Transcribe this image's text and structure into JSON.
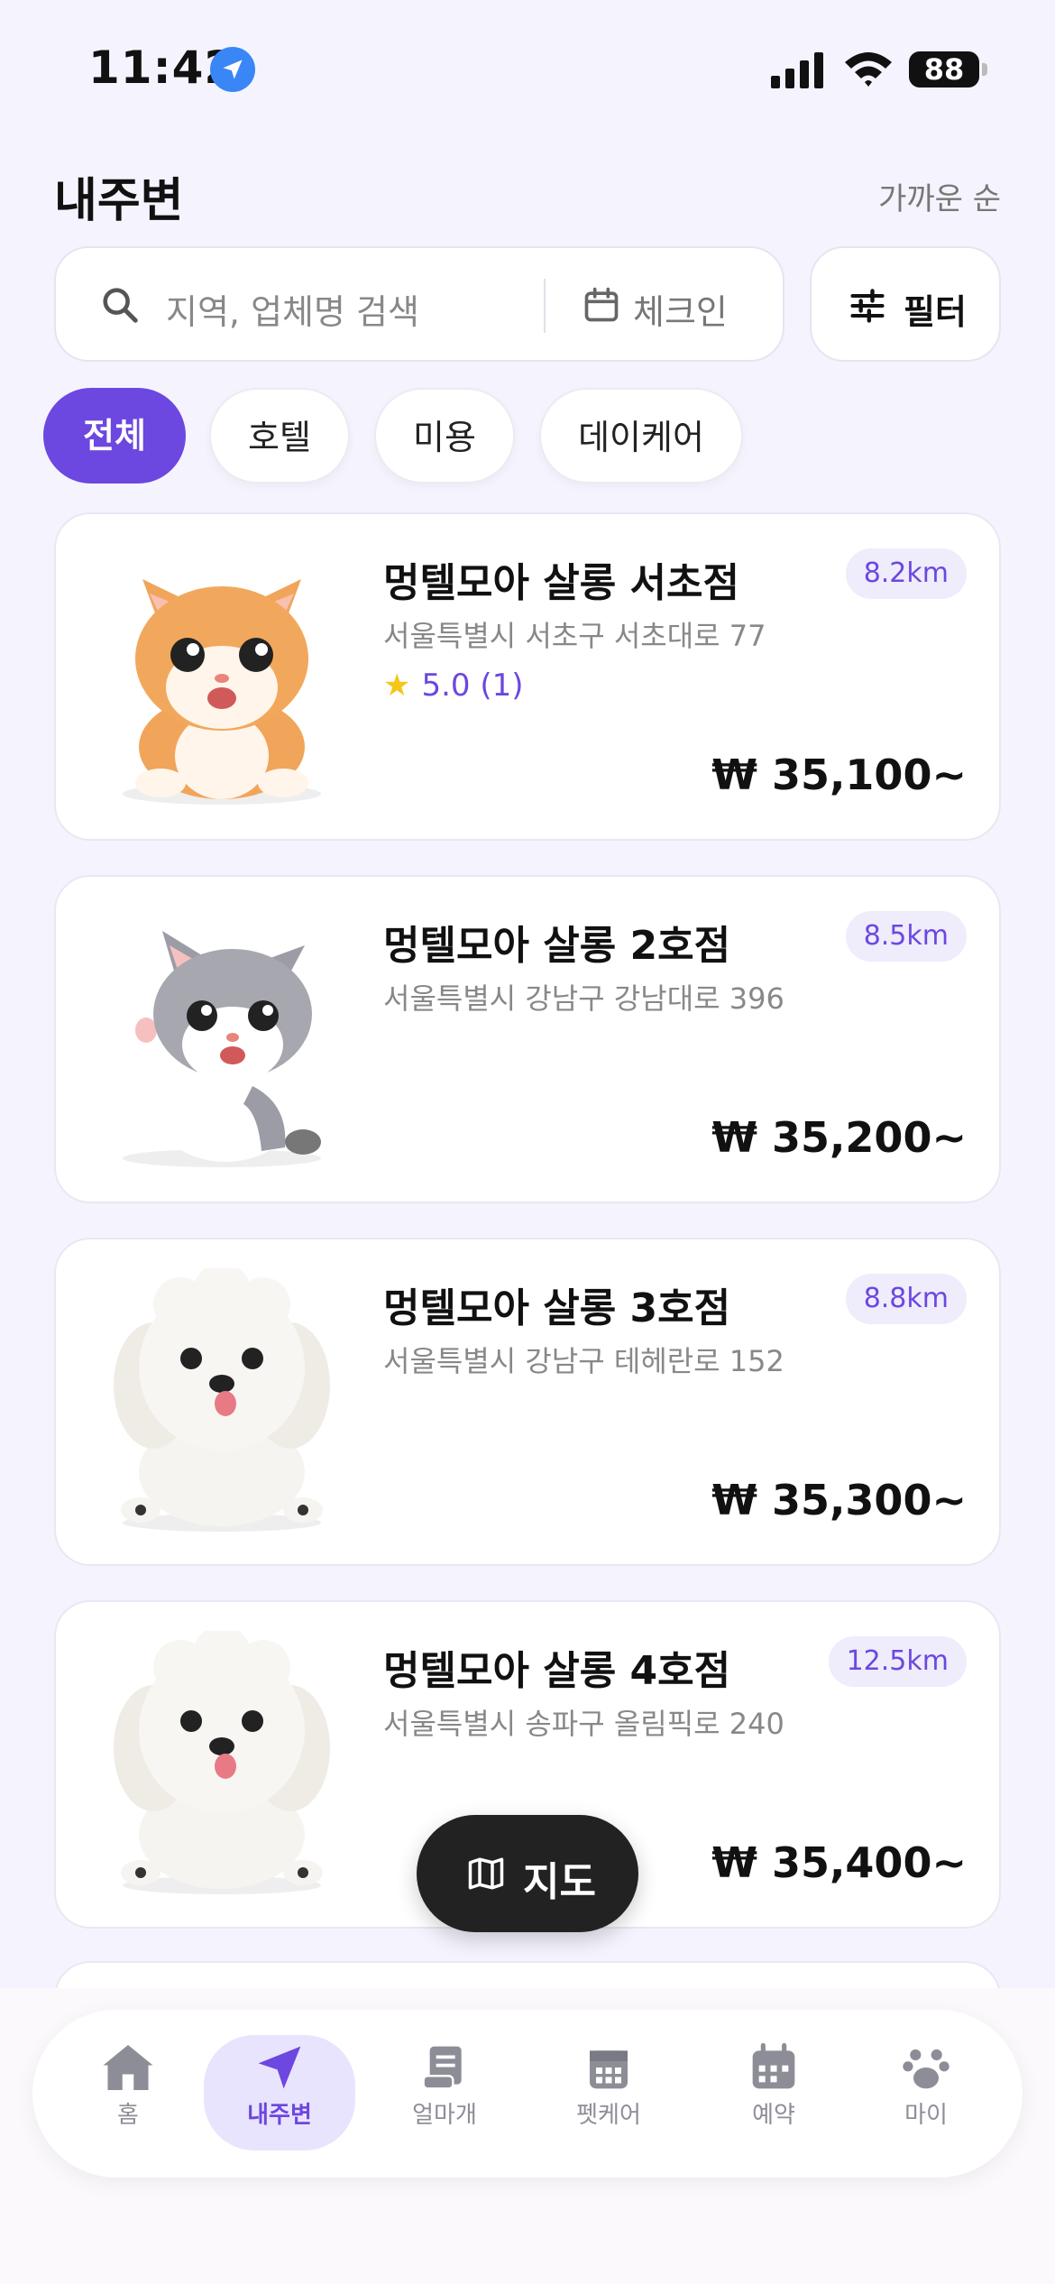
{
  "status": {
    "time": "11:42",
    "battery": "88"
  },
  "header": {
    "title": "내주변",
    "sort": "가까운 순"
  },
  "search": {
    "placeholder": "지역, 업체명 검색",
    "checkin": "체크인",
    "filter": "필터"
  },
  "chips": [
    "전체",
    "호텔",
    "미용",
    "데이케어"
  ],
  "cards": [
    {
      "name": "멍텔모아 살롱 서초점",
      "address": "서울특별시 서초구 서초대로 77",
      "distance": "8.2km",
      "rating": "5.0 (1)",
      "price": "₩ 35,100~",
      "pet": "orange-kitten"
    },
    {
      "name": "멍텔모아 살롱 2호점",
      "address": "서울특별시 강남구 강남대로 396",
      "distance": "8.5km",
      "price": "₩ 35,200~",
      "pet": "gray-kitten"
    },
    {
      "name": "멍텔모아 살롱 3호점",
      "address": "서울특별시 강남구 테헤란로 152",
      "distance": "8.8km",
      "price": "₩ 35,300~",
      "pet": "white-puppy"
    },
    {
      "name": "멍텔모아 살롱 4호점",
      "address": "서울특별시 송파구 올림픽로 240",
      "distance": "12.5km",
      "price": "₩ 35,400~",
      "pet": "white-puppy"
    }
  ],
  "map_button": "지도",
  "nav": [
    {
      "label": "홈",
      "icon": "home-icon"
    },
    {
      "label": "내주변",
      "icon": "location-arrow-icon",
      "active": true
    },
    {
      "label": "얼마개",
      "icon": "receipt-icon"
    },
    {
      "label": "펫케어",
      "icon": "calendar-grid-icon"
    },
    {
      "label": "예약",
      "icon": "calendar-icon"
    },
    {
      "label": "마이",
      "icon": "paw-icon"
    }
  ],
  "colors": {
    "accent": "#6c47e0",
    "background": "#f5f4fe",
    "dark": "#222222"
  }
}
